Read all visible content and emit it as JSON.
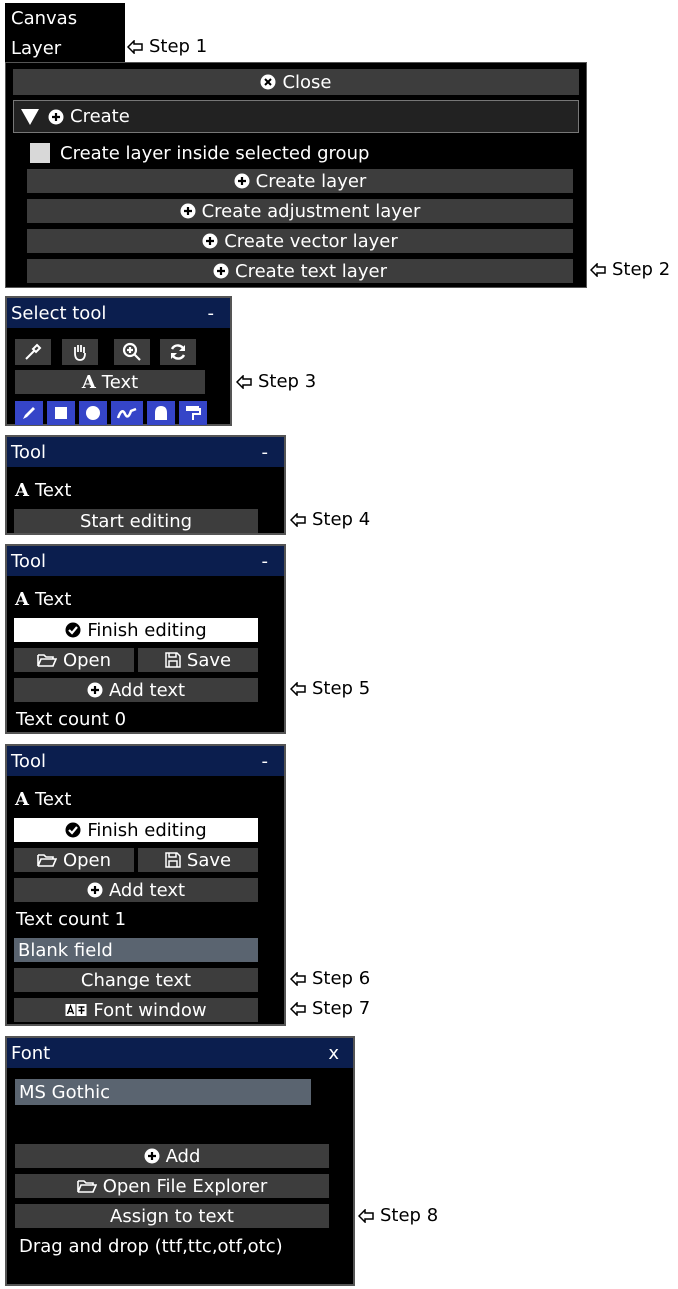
{
  "menu": {
    "canvas": "Canvas",
    "layer": "Layer"
  },
  "steps": {
    "s1": "Step 1",
    "s2": "Step 2",
    "s3": "Step 3",
    "s4": "Step 4",
    "s5": "Step 5",
    "s6": "Step 6",
    "s7": "Step 7",
    "s8": "Step 8"
  },
  "layer_panel": {
    "close": "Close",
    "create_section": "Create",
    "inside_group": "Create layer inside selected group",
    "create_layer": "Create layer",
    "create_adjustment": "Create adjustment layer",
    "create_vector": "Create vector layer",
    "create_text": "Create text layer"
  },
  "select_tool": {
    "title": "Select tool",
    "minimize": "-",
    "text_button": "Text",
    "icons": [
      "eyedropper-icon",
      "hand-icon",
      "zoom-icon",
      "refresh-icon"
    ],
    "brush_icons": [
      "pen-icon",
      "square-icon",
      "circle-icon",
      "stroke-icon",
      "bell-shape-icon",
      "paint-roller-icon"
    ]
  },
  "tool_panel_1": {
    "title": "Tool",
    "minimize": "-",
    "tool_name": "Text",
    "start_editing": "Start editing"
  },
  "tool_panel_2": {
    "title": "Tool",
    "minimize": "-",
    "tool_name": "Text",
    "finish_editing": "Finish editing",
    "open": "Open",
    "save": "Save",
    "add_text": "Add text",
    "text_count": "Text count 0"
  },
  "tool_panel_3": {
    "title": "Tool",
    "minimize": "-",
    "tool_name": "Text",
    "finish_editing": "Finish editing",
    "open": "Open",
    "save": "Save",
    "add_text": "Add text",
    "text_count": "Text count 1",
    "field_value": "Blank field",
    "change_text": "Change text",
    "font_window": "Font window"
  },
  "font_panel": {
    "title": "Font",
    "close": "x",
    "font_value": "MS Gothic",
    "add": "Add",
    "open_explorer": "Open File Explorer",
    "assign": "Assign to text",
    "hint": "Drag and drop (ttf,ttc,otf,otc)"
  },
  "colors": {
    "panel_bg": "#000000",
    "button_bg": "#3d3d3d",
    "title_bg": "#0b1e4e",
    "field_bg": "#5a6470",
    "tool_blue": "#3545c8"
  }
}
